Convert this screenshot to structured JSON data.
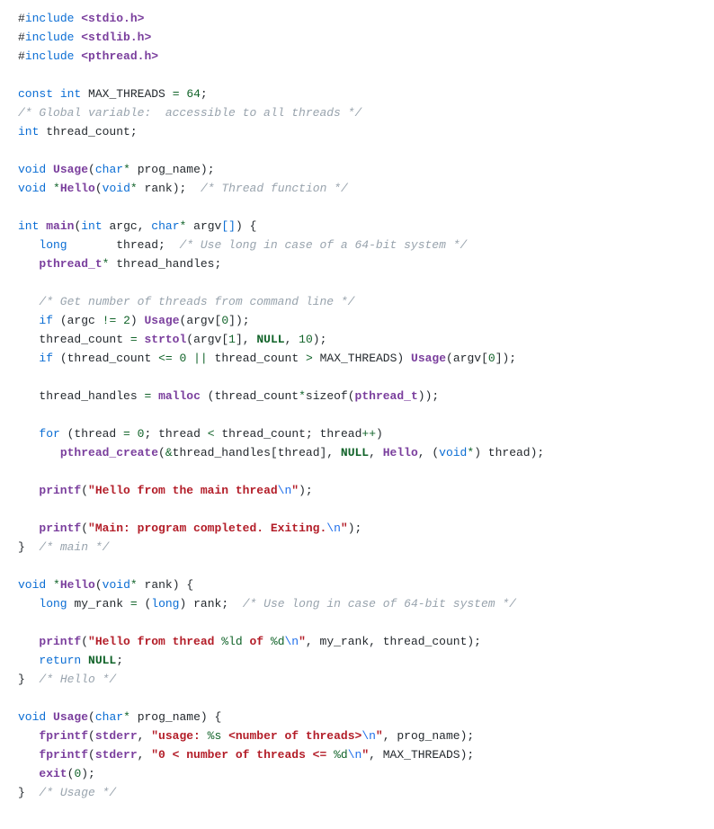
{
  "code": {
    "l01": {
      "pp": "include",
      "inc": "<stdio.h>"
    },
    "l02": {
      "pp": "include",
      "inc": "<stdlib.h>"
    },
    "l03": {
      "pp": "include",
      "inc": "<pthread.h>"
    },
    "l05": {
      "const": "const",
      "int": "int",
      "name": "MAX_THREADS",
      "eq": "=",
      "val": "64"
    },
    "l06": "/* Global variable:  accessible to all threads */",
    "l07": {
      "int": "int",
      "name": "thread_count"
    },
    "l09": {
      "void": "void",
      "fn": "Usage",
      "char": "char",
      "arg": "prog_name"
    },
    "l10": {
      "void": "void",
      "fn": "Hello",
      "argtype": "void",
      "arg": "rank",
      "cmt": "/* Thread function */"
    },
    "l12": {
      "int": "int",
      "fn": "main",
      "argc_t": "int",
      "argc": "argc",
      "char": "char",
      "argv": "argv"
    },
    "l13": {
      "long": "long",
      "name": "thread",
      "cmt": "/* Use long in case of a 64-bit system */"
    },
    "l14": {
      "type": "pthread_t",
      "name": "thread_handles"
    },
    "l16": "/* Get number of threads from command line */",
    "l17": {
      "if": "if",
      "argc": "argc",
      "ne": "!=",
      "two": "2",
      "fn": "Usage",
      "argv": "argv",
      "zero": "0"
    },
    "l18": {
      "tc": "thread_count",
      "eq": "=",
      "fn": "strtol",
      "argv": "argv",
      "one": "1",
      "null": "NULL",
      "ten": "10"
    },
    "l19": {
      "if": "if",
      "tc": "thread_count",
      "le": "<=",
      "zero": "0",
      "or": "||",
      "tc2": "thread_count",
      "gt": ">",
      "max": "MAX_THREADS",
      "fn": "Usage",
      "argv": "argv",
      "zero2": "0"
    },
    "l21": {
      "th": "thread_handles",
      "eq": "=",
      "fn": "malloc",
      "tc": "thread_count",
      "sz": "sizeof",
      "type": "pthread_t"
    },
    "l23": {
      "for": "for",
      "th": "thread",
      "eq": "=",
      "zero": "0",
      "th2": "thread",
      "lt": "<",
      "tc": "thread_count",
      "th3": "thread"
    },
    "l24": {
      "fn": "pthread_create",
      "amp": "&",
      "th": "thread_handles",
      "idx": "thread",
      "null": "NULL",
      "hello": "Hello",
      "void": "void",
      "thr": "thread"
    },
    "l26": {
      "fn": "printf",
      "str": "\"Hello from the main thread",
      "esc": "\\n",
      "end": "\""
    },
    "l28": {
      "fn": "printf",
      "str": "\"Main: program completed. Exiting.",
      "esc": "\\n",
      "end": "\""
    },
    "l29": {
      "brace": "}",
      "cmt": "/* main */"
    },
    "l31": {
      "void": "void",
      "fn": "Hello",
      "vt": "void",
      "arg": "rank"
    },
    "l32": {
      "long": "long",
      "mr": "my_rank",
      "eq": "=",
      "long2": "long",
      "rank": "rank",
      "cmt": "/* Use long in case of 64-bit system */"
    },
    "l34": {
      "fn": "printf",
      "s1": "\"Hello from thread ",
      "f1": "%ld",
      "s2": " of ",
      "f2": "%d",
      "esc": "\\n",
      "end": "\"",
      "a1": "my_rank",
      "a2": "thread_count"
    },
    "l35": {
      "ret": "return",
      "null": "NULL"
    },
    "l36": {
      "brace": "}",
      "cmt": "/* Hello */"
    },
    "l38": {
      "void": "void",
      "fn": "Usage",
      "char": "char",
      "arg": "prog_name"
    },
    "l39": {
      "fn": "fprintf",
      "stderr": "stderr",
      "s1": "\"usage: ",
      "f1": "%s",
      "s2": " <number of threads>",
      "esc": "\\n",
      "end": "\"",
      "a1": "prog_name"
    },
    "l40": {
      "fn": "fprintf",
      "stderr": "stderr",
      "s1": "\"0 < number of threads <= ",
      "f1": "%d",
      "esc": "\\n",
      "end": "\"",
      "a1": "MAX_THREADS"
    },
    "l41": {
      "fn": "exit",
      "zero": "0"
    },
    "l42": {
      "brace": "}",
      "cmt": "/* Usage */"
    }
  }
}
